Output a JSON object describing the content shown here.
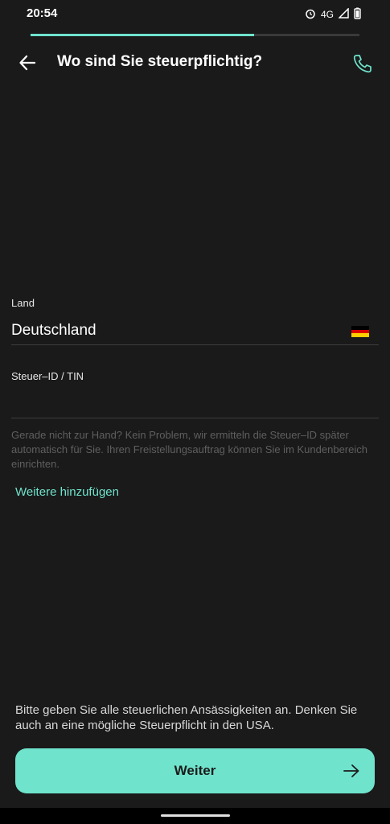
{
  "status_bar": {
    "time": "20:54",
    "network": "4G"
  },
  "progress": {
    "fraction": 0.68
  },
  "header": {
    "title": "Wo sind Sie steuerpflichtig?",
    "back_icon": "arrow-left-icon",
    "phone_icon": "phone-icon"
  },
  "form": {
    "country_label": "Land",
    "country_value": "Deutschland",
    "country_flag": "german-flag-icon",
    "tax_id_label": "Steuer–ID / TIN",
    "tax_id_value": "",
    "hint": "Gerade nicht zur Hand? Kein Problem, wir ermitteln die Steuer–ID später automatisch für Sie. Ihren Freistellungsauftrag können Sie im Kundenbereich einrichten.",
    "add_more_label": "Weitere hinzufügen"
  },
  "footer": {
    "note": "Bitte geben Sie alle steuerlichen Ansässigkeiten an. Denken Sie auch an eine mögliche Steuerpflicht in den USA.",
    "cta_label": "Weiter",
    "cta_icon": "arrow-right-icon"
  },
  "colors": {
    "accent": "#6fe3cc",
    "background": "#1a1a1a"
  }
}
